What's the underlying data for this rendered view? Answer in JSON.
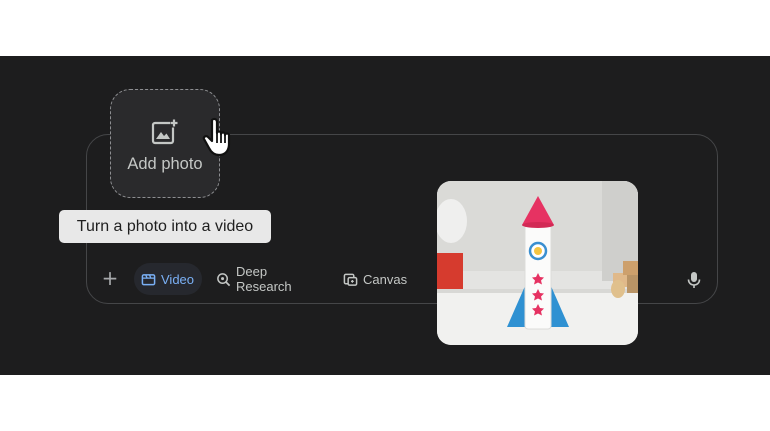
{
  "add_photo": {
    "label": "Add photo",
    "icon": "add-photo-icon"
  },
  "tooltip": {
    "text": "Turn a photo into a video"
  },
  "toolbar": {
    "plus_icon": "plus-icon",
    "video_label": "Video",
    "deep_research_label": "Deep Research",
    "canvas_label": "Canvas",
    "mic_icon": "mic-icon"
  },
  "colors": {
    "panel_bg": "#1d1d1e",
    "active_chip_text": "#7ab0f5",
    "tooltip_bg": "#e8e8e8"
  }
}
